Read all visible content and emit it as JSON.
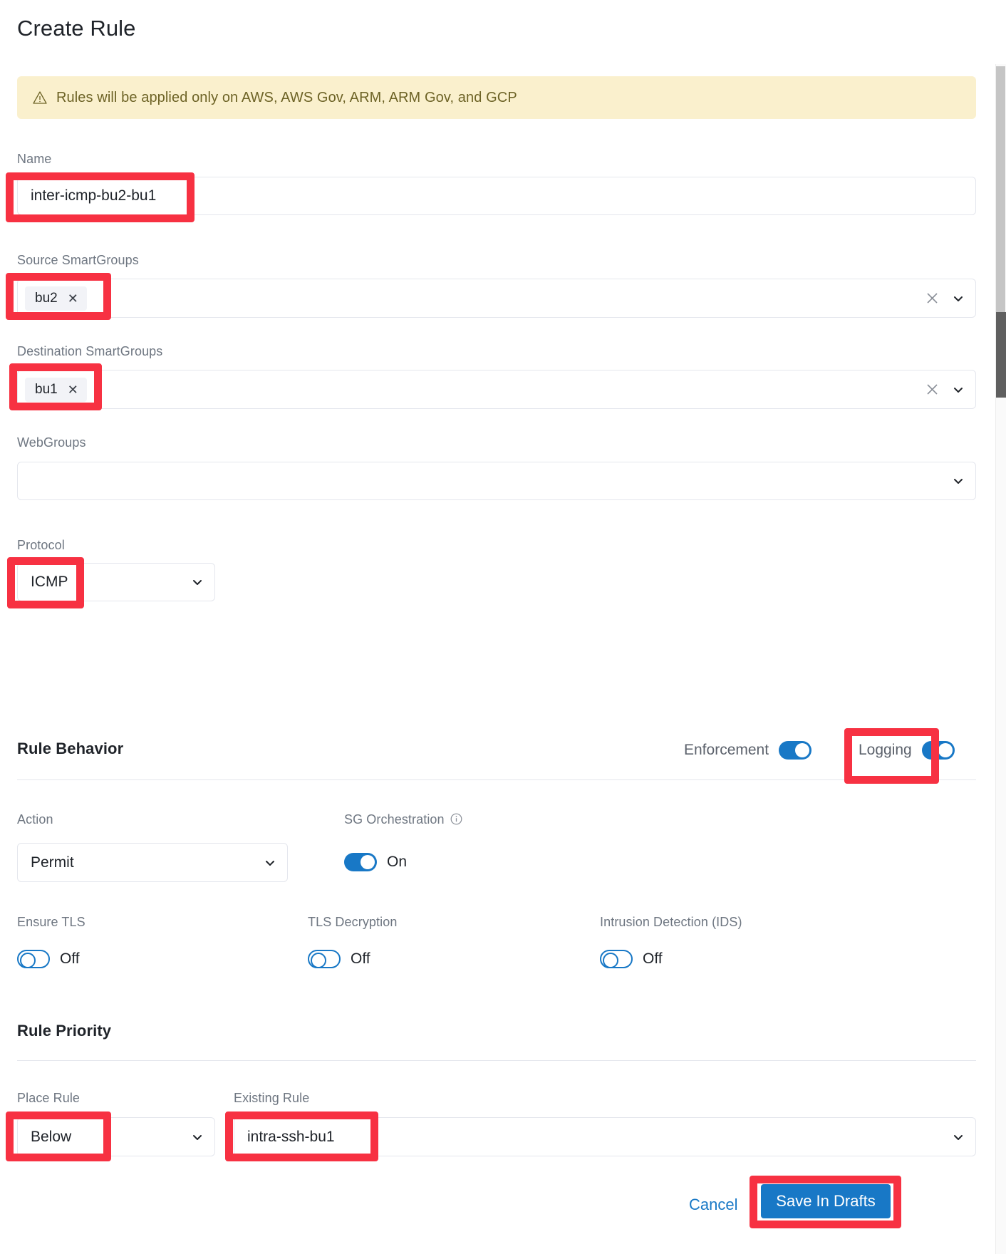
{
  "page": {
    "title": "Create Rule"
  },
  "banner": {
    "icon": "warning-triangle-icon",
    "text": "Rules will be applied only on AWS, AWS Gov, ARM, ARM Gov, and GCP",
    "bg_color": "#faf0cd",
    "text_color": "#6d6326"
  },
  "form": {
    "name": {
      "label": "Name",
      "value": "inter-icmp-bu2-bu1",
      "placeholder": ""
    },
    "source_smartgroups": {
      "label": "Source SmartGroups",
      "chips": [
        "bu2"
      ],
      "clear_icon": "clear-icon",
      "chevron_icon": "chevron-down-icon"
    },
    "destination_smartgroups": {
      "label": "Destination SmartGroups",
      "chips": [
        "bu1"
      ],
      "clear_icon": "clear-icon",
      "chevron_icon": "chevron-down-icon"
    },
    "webgroups": {
      "label": "WebGroups",
      "value": "",
      "chevron_icon": "chevron-down-icon"
    },
    "protocol": {
      "label": "Protocol",
      "value": "ICMP",
      "chevron_icon": "chevron-down-icon"
    }
  },
  "rule_behavior": {
    "heading": "Rule Behavior",
    "enforcement": {
      "label": "Enforcement",
      "state": "on"
    },
    "logging": {
      "label": "Logging",
      "state": "on"
    },
    "action": {
      "label": "Action",
      "value": "Permit",
      "chevron_icon": "chevron-down-icon"
    },
    "sg_orchestration": {
      "label": "SG Orchestration",
      "info_icon": "info-icon",
      "state": "on",
      "state_label": "On"
    },
    "ensure_tls": {
      "label": "Ensure TLS",
      "state": "off",
      "state_label": "Off"
    },
    "tls_decryption": {
      "label": "TLS Decryption",
      "state": "off",
      "state_label": "Off"
    },
    "intrusion_detection": {
      "label": "Intrusion Detection (IDS)",
      "state": "off",
      "state_label": "Off"
    }
  },
  "rule_priority": {
    "heading": "Rule Priority",
    "place_rule": {
      "label": "Place Rule",
      "value": "Below",
      "chevron_icon": "chevron-down-icon"
    },
    "existing_rule": {
      "label": "Existing Rule",
      "value": "intra-ssh-bu1",
      "chevron_icon": "chevron-down-icon"
    }
  },
  "footer": {
    "cancel_label": "Cancel",
    "save_label": "Save In Drafts",
    "primary_color": "#1878c6"
  },
  "annotations": {
    "color": "#f73142",
    "count": 8
  }
}
